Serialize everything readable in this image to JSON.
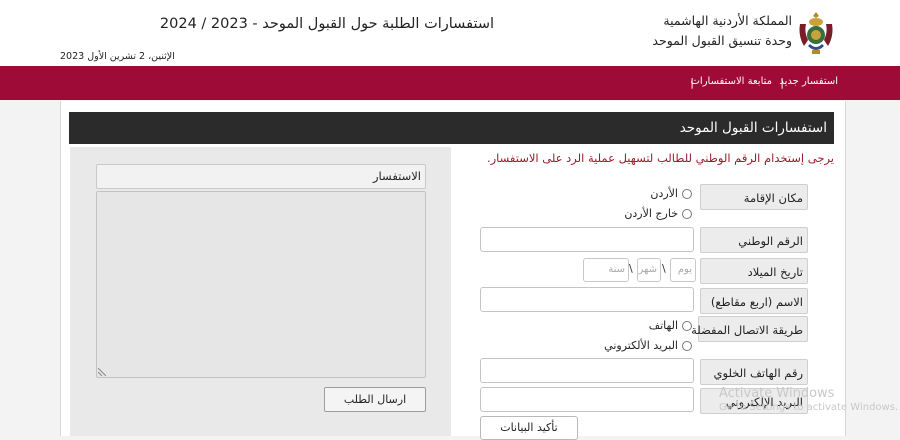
{
  "header": {
    "org_line1": "المملكة الأردنية الهاشمية",
    "org_line2": "وحدة تنسيق القبول الموحد",
    "site_title": "استفسارات الطلبة حول القبول الموحد - 2023 / 2024",
    "date": "الإثنين، 2 تشرين الأول 2023"
  },
  "nav": {
    "new_inquiry": "استفسار جديد",
    "follow_up": "متابعة الاستفسارات",
    "separator": "|"
  },
  "panel": {
    "title": "استفسارات القبول الموحد",
    "notice": "يرجى إستخدام الرقم الوطني للطالب لتسهيل عملية الرد على الاستفسار."
  },
  "form": {
    "residence_label": "مكان الإقامة",
    "residence_options": [
      "الأردن",
      "خارج الأردن"
    ],
    "national_id_label": "الرقم الوطني",
    "birthdate_label": "تاريخ الميلاد",
    "birthdate_placeholders": {
      "day": "يوم",
      "month": "شهر",
      "year": "سنة"
    },
    "birthdate_separator": "\\",
    "name_label": "الاسم (اربع مقاطع)",
    "contact_method_label": "طريقة الاتصال المفضلة",
    "contact_options": [
      "الهاتف",
      "البريد الألكتروني"
    ],
    "mobile_label": "رقم الهاتف الخلوي",
    "email_label": "البريد الإلكتروني",
    "confirm_button": "تأكيد البيانات"
  },
  "inquiry": {
    "label": "الاستفسار",
    "send_button": "ارسال الطلب"
  },
  "watermark": {
    "line1": "Activate Windows",
    "line2": "Go to Settings to activate Windows."
  },
  "colors": {
    "nav_bar": "#9e0b36",
    "panel_header": "#2b2b2b",
    "notice_text": "#9b1b2c"
  }
}
